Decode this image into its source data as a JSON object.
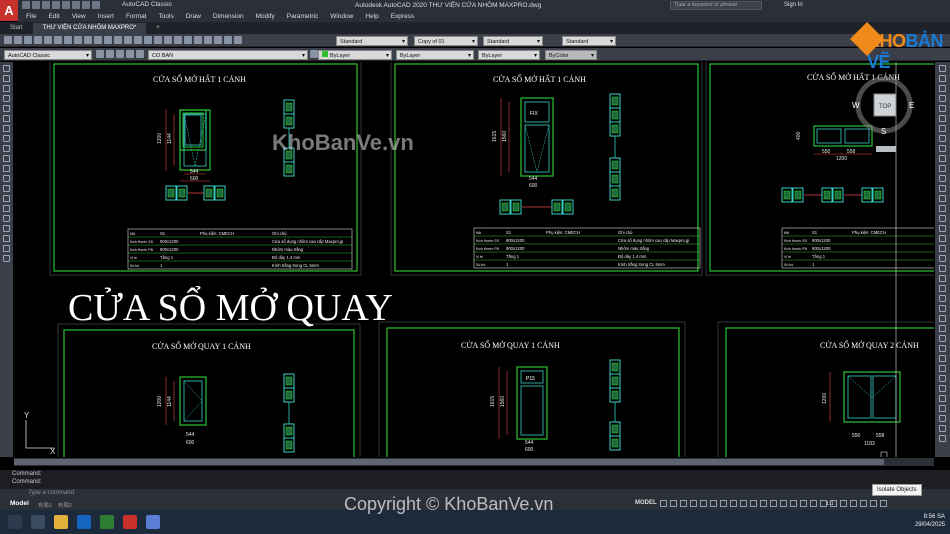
{
  "window": {
    "app_title": "Autodesk AutoCAD 2020   THƯ VIỆN CỬA NHÔM MAXPRO.dwg",
    "workspace": "AutoCAD Classic",
    "search_placeholder": "Type a keyword or phrase",
    "sign_in": "Sign In"
  },
  "menu": [
    "File",
    "Edit",
    "View",
    "Insert",
    "Format",
    "Tools",
    "Draw",
    "Dimension",
    "Modify",
    "Parametric",
    "Window",
    "Help",
    "Express"
  ],
  "tabs": {
    "start": "Start",
    "drawing": "THƯ VIỆN CỬA NHÔM MAXPRO*",
    "add": "+"
  },
  "toolbar": {
    "text_style": "Standard",
    "copy": "Copy of 01",
    "table_style": "Standard",
    "mleader_style": "Standard",
    "workspace_select": "AutoCAD Classic",
    "layer": "CO BAN",
    "color": "ByLayer",
    "linetype": "ByLayer",
    "lineweight": "ByLayer",
    "plot_style": "ByColor"
  },
  "drawing": {
    "titles_top": [
      "CỬA SỔ MỞ HẤT 1 CÁNH",
      "CỬA SỔ MỞ HẤT 1 CÁNH",
      "CỬA SỔ MỞ HẤT 1 CÁNH"
    ],
    "section_heading": "CỬA SỔ MỞ QUAY",
    "titles_bottom": [
      "CỬA SỔ MỞ QUAY 1 CÁNH",
      "CỬA SỔ MỞ QUAY 1 CÁNH",
      "CỬA SỔ MỞ QUAY 2 CÁNH"
    ],
    "fix_label": "FIX",
    "p15_label": "P15",
    "table1": {
      "head": [
        "Mã",
        "S1",
        "Phụ kiện: CMECH",
        "Ghi chú"
      ],
      "rows": [
        [
          "Kích thước SS",
          "900x1200",
          "",
          "Cửa sổ dụng nhôm cao cấp Maxpro.jp"
        ],
        [
          "Kích thước PB",
          "900x1200",
          "",
          "Nhôm màu trắng"
        ],
        [
          "Vị trí",
          "Tầng 1",
          "",
          "Độ dày 1.4 mm"
        ],
        [
          "Số bộ",
          "1",
          "",
          "Kính trắng trong CL 5mm"
        ]
      ]
    },
    "table2": {
      "head": [
        "Mã",
        "S1",
        "Phụ kiện: CMECH",
        "Ghi chú"
      ],
      "rows": [
        [
          "Kích thước SS",
          "900x1200",
          "",
          "Cửa sổ dụng nhôm cao cấp Maxpro.jp"
        ],
        [
          "Kích thước PB",
          "900x1200",
          "",
          "Nhôm màu trắng"
        ],
        [
          "Vị trí",
          "Tầng 1",
          "",
          "Độ dày 1.4 mm"
        ],
        [
          "Số bộ",
          "1",
          "",
          "Kính trắng trong CL 5mm"
        ]
      ]
    },
    "table3": {
      "head": [
        "Mã",
        "S1",
        "Phụ kiện: CMECH"
      ],
      "rows": [
        [
          "Kích thước SS",
          "900x1200",
          ""
        ],
        [
          "Kích thước PB",
          "900x1200",
          ""
        ],
        [
          "Vị trí",
          "Tầng 1",
          ""
        ],
        [
          "Số bộ",
          "1",
          ""
        ]
      ]
    },
    "dims": {
      "d1200": "1200",
      "d1144": "1144",
      "d544": "544",
      "d600": "600",
      "d1615": "1615",
      "d1560": "1560",
      "d456": "456",
      "d1583": "1583",
      "d550": "550",
      "d558": "558",
      "d1183": "1183",
      "d400": "400"
    },
    "ucs_x": "X",
    "ucs_y": "Y"
  },
  "viewcube": {
    "top": "TOP",
    "n": "N",
    "s": "S",
    "w": "W",
    "e": "E"
  },
  "command": {
    "line1": "Command:",
    "line2": "Command:",
    "placeholder": "Type a command"
  },
  "status": {
    "model": "Model",
    "layout1": "布局1",
    "layout2": "布局2",
    "model_btn": "MODEL",
    "scale": "1:1"
  },
  "tooltip": "Isolate Objects",
  "clock": {
    "time": "8:56 SA",
    "date": "29/04/2025"
  },
  "watermark": {
    "top": "KhoBanVe.vn",
    "bottom": "Copyright © KhoBanVe.vn"
  },
  "brand": {
    "part1": "KHO",
    "part2": "BẢN VẼ"
  },
  "colors": {
    "accent": "#c8322c",
    "frame": "#2ec22e",
    "text": "#ffffff",
    "brand_orange": "#f08a1a",
    "brand_blue": "#1a7ad4"
  }
}
